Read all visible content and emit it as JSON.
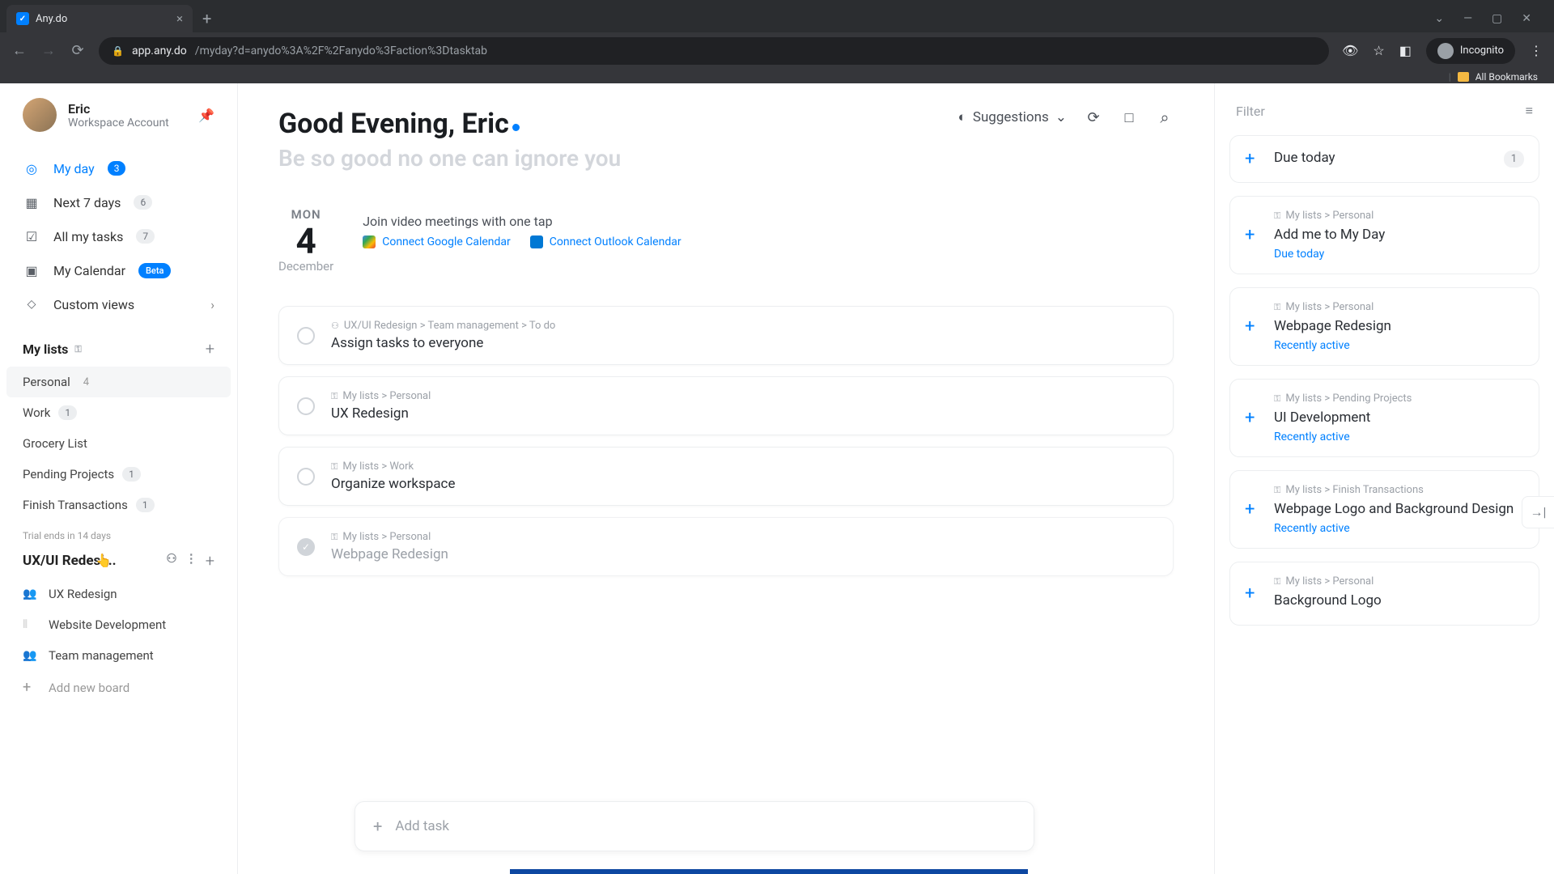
{
  "browser": {
    "tab_title": "Any.do",
    "url_host": "app.any.do",
    "url_path": "/myday?d=anydo%3A%2F%2Fanydo%3Faction%3Dtasktab",
    "incognito_label": "Incognito",
    "all_bookmarks": "All Bookmarks"
  },
  "profile": {
    "name": "Eric",
    "subtitle": "Workspace Account"
  },
  "nav": {
    "my_day": {
      "label": "My day",
      "count": "3"
    },
    "next7": {
      "label": "Next 7 days",
      "count": "6"
    },
    "all_tasks": {
      "label": "All my tasks",
      "count": "7"
    },
    "calendar": {
      "label": "My Calendar",
      "badge": "Beta"
    },
    "custom_views": {
      "label": "Custom views"
    }
  },
  "my_lists": {
    "heading": "My lists",
    "items": [
      {
        "label": "Personal",
        "count": "4"
      },
      {
        "label": "Work",
        "count": "1"
      },
      {
        "label": "Grocery List",
        "count": ""
      },
      {
        "label": "Pending Projects",
        "count": "1"
      },
      {
        "label": "Finish Transactions",
        "count": "1"
      }
    ]
  },
  "trial_note": "Trial ends in 14 days",
  "workspace": {
    "heading": "UX/UI Redesi...",
    "boards": [
      {
        "icon": "👥",
        "label": "UX Redesign"
      },
      {
        "icon": "⦀",
        "label": "Website Development"
      },
      {
        "icon": "👥",
        "label": "Team management"
      }
    ],
    "add_board": "Add new board"
  },
  "main": {
    "greeting": "Good Evening, Eric",
    "subtitle": "Be so good no one can ignore you",
    "suggestions_label": "Suggestions",
    "date": {
      "dow": "MON",
      "day": "4",
      "month": "December"
    },
    "connect_prompt": "Join video meetings with one tap",
    "connect_google": "Connect Google Calendar",
    "connect_outlook": "Connect Outlook Calendar",
    "tasks": [
      {
        "crumb_icon": "people",
        "crumb": "UX/UI Redesign > Team management > To do",
        "title": "Assign tasks to everyone",
        "done": false
      },
      {
        "crumb_icon": "lock",
        "crumb": "My lists > Personal",
        "title": "UX Redesign",
        "done": false
      },
      {
        "crumb_icon": "lock",
        "crumb": "My lists > Work",
        "title": "Organize workspace",
        "done": false
      },
      {
        "crumb_icon": "lock",
        "crumb": "My lists > Personal",
        "title": "Webpage Redesign",
        "done": true
      }
    ],
    "add_task_placeholder": "Add task"
  },
  "right": {
    "filter_label": "Filter",
    "cards": [
      {
        "crumb": "",
        "title": "Due today",
        "meta": "",
        "count": "1"
      },
      {
        "crumb": "My lists > Personal",
        "title": "Add me to My Day",
        "meta": "Due today",
        "count": ""
      },
      {
        "crumb": "My lists > Personal",
        "title": "Webpage Redesign",
        "meta": "Recently active",
        "count": ""
      },
      {
        "crumb": "My lists > Pending Projects",
        "title": "UI Development",
        "meta": "Recently active",
        "count": ""
      },
      {
        "crumb": "My lists > Finish Transactions",
        "title": "Webpage Logo and Background Design",
        "meta": "Recently active",
        "count": ""
      },
      {
        "crumb": "My lists > Personal",
        "title": "Background Logo",
        "meta": "",
        "count": ""
      }
    ]
  }
}
